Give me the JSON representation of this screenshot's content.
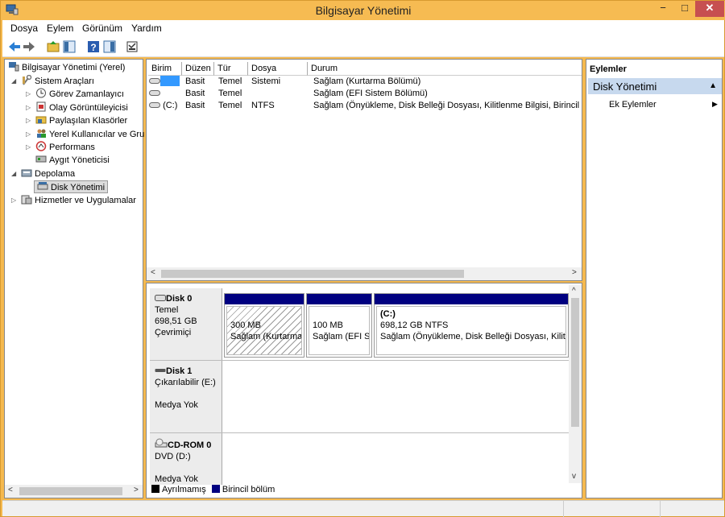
{
  "window": {
    "title": "Bilgisayar Yönetimi",
    "minimize": "−",
    "maximize": "□",
    "close": "✕"
  },
  "menu": [
    "Dosya",
    "Eylem",
    "Görünüm",
    "Yardım"
  ],
  "tree": {
    "root": "Bilgisayar Yönetimi (Yerel)",
    "system_tools": "Sistem Araçları",
    "task_scheduler": "Görev Zamanlayıcı",
    "event_viewer": "Olay Görüntüleyicisi",
    "shared_folders": "Paylaşılan Klasörler",
    "local_users": "Yerel Kullanıcılar ve Gru",
    "performance": "Performans",
    "device_manager": "Aygıt Yöneticisi",
    "storage": "Depolama",
    "disk_management": "Disk Yönetimi",
    "services": "Hizmetler ve Uygulamalar"
  },
  "volume_table": {
    "columns": [
      "Birim",
      "Düzen",
      "Tür",
      "Dosya Sistemi",
      "Durum"
    ],
    "rows": [
      {
        "volume": "",
        "layout": "Basit",
        "type": "Temel",
        "fs": "",
        "status": "Sağlam (Kurtarma Bölümü)"
      },
      {
        "volume": "",
        "layout": "Basit",
        "type": "Temel",
        "fs": "",
        "status": "Sağlam (EFI Sistem Bölümü)"
      },
      {
        "volume": "(C:)",
        "layout": "Basit",
        "type": "Temel",
        "fs": "NTFS",
        "status": "Sağlam (Önyükleme, Disk Belleği Dosyası, Kilitlenme Bilgisi, Birincil bö"
      }
    ]
  },
  "disks": {
    "disk0": {
      "name": "Disk 0",
      "kind": "Temel",
      "size": "698,51 GB",
      "state": "Çevrimiçi",
      "parts": [
        {
          "size": "300 MB",
          "status": "Sağlam (Kurtarma"
        },
        {
          "size": "100 MB",
          "status": "Sağlam (EFI Si:"
        },
        {
          "label": "(C:)",
          "size": "698,12 GB NTFS",
          "status": "Sağlam (Önyükleme, Disk Belleği Dosyası, Kilitle"
        }
      ]
    },
    "disk1": {
      "name": "Disk 1",
      "kind": "Çıkarılabilir (E:)",
      "state": "Medya Yok"
    },
    "cdrom0": {
      "name": "CD-ROM 0",
      "kind": "DVD (D:)",
      "state": "Medya Yok"
    }
  },
  "legend": {
    "unallocated": "Ayrılmamış",
    "primary": "Birincil bölüm"
  },
  "colors": {
    "primary_partition": "#000080",
    "unallocated": "#000000",
    "title_bar": "#f6bb52",
    "close_button": "#c75050",
    "selection": "#c7d9ee"
  },
  "actions": {
    "header": "Eylemler",
    "section": "Disk Yönetimi",
    "more": "Ek Eylemler"
  }
}
